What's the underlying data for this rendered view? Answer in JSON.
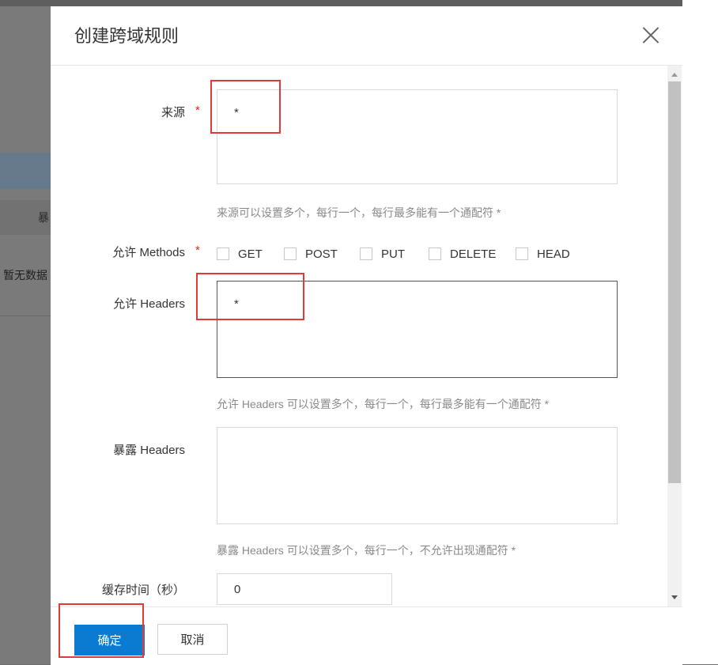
{
  "background": {
    "row_text": "暴",
    "empty_text": "暂无数据"
  },
  "dialog": {
    "title": "创建跨域规则",
    "close_icon": "close-icon"
  },
  "form": {
    "origin": {
      "label": "来源",
      "required_mark": "*",
      "value": "*",
      "hint": "来源可以设置多个，每行一个，每行最多能有一个通配符 *"
    },
    "methods": {
      "label": "允许 Methods",
      "required_mark": "*",
      "options": [
        {
          "label": "GET",
          "checked": false
        },
        {
          "label": "POST",
          "checked": false
        },
        {
          "label": "PUT",
          "checked": false
        },
        {
          "label": "DELETE",
          "checked": false
        },
        {
          "label": "HEAD",
          "checked": false
        }
      ]
    },
    "allow_headers": {
      "label": "允许 Headers",
      "value": "*",
      "hint": "允许 Headers 可以设置多个，每行一个，每行最多能有一个通配符 *"
    },
    "expose_headers": {
      "label": "暴露 Headers",
      "value": "",
      "hint": "暴露 Headers 可以设置多个，每行一个，不允许出现通配符 *"
    },
    "cache_time": {
      "label": "缓存时间（秒）",
      "value": "0"
    }
  },
  "footer": {
    "ok_label": "确定",
    "cancel_label": "取消"
  },
  "colors": {
    "primary": "#0b7ad1",
    "required": "#e0281d",
    "annotation": "#e03a3a"
  }
}
